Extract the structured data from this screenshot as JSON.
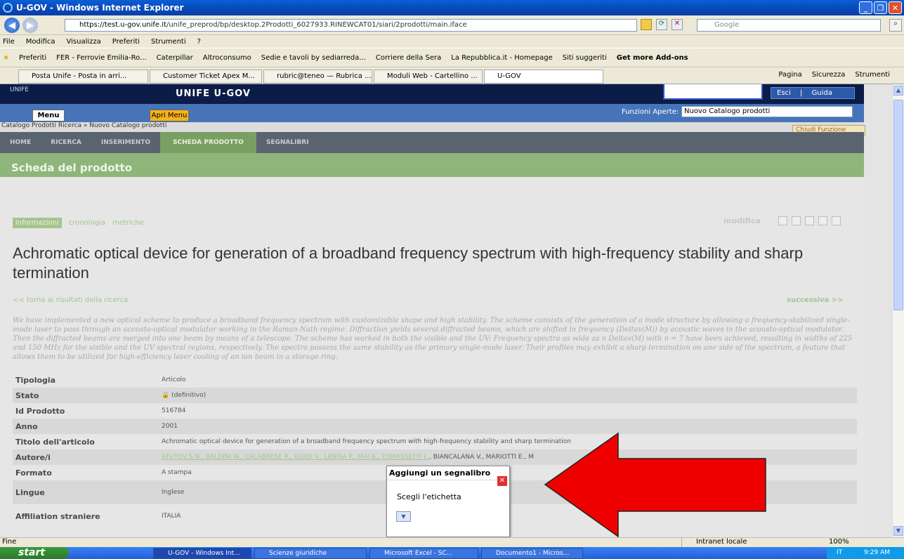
{
  "window": {
    "title": "U-GOV - Windows Internet Explorer"
  },
  "address": {
    "url_prefix": "https://test.u-gov.unife.it",
    "url_rest": "/unife_preprod/bp/desktop.2Prodotti_6027933.RINEWCAT01/siari/2prodotti/main.iface",
    "search_placeholder": "Google"
  },
  "menubar": [
    "File",
    "Modifica",
    "Visualizza",
    "Preferiti",
    "Strumenti",
    "?"
  ],
  "favorites": [
    "Preferiti",
    "FER - Ferrovie Emilia-Ro...",
    "Caterpillar",
    "Altroconsumo",
    "Sedie e tavoli by sediarreda...",
    "Corriere della Sera",
    "La Repubblica.it - Homepage",
    "Siti suggeriti",
    "Get more Add-ons"
  ],
  "tabs": [
    "Posta Unife - Posta in arri...",
    "Customer Ticket Apex M...",
    "rubric@teneo — Rubrica ...",
    "Moduli Web - Cartellino ...",
    "U-GOV"
  ],
  "tab_tools": [
    "Pagina",
    "Sicurezza",
    "Strumenti"
  ],
  "app": {
    "header_title": "UNIFE U-GOV",
    "logo_text": "UNIFE",
    "esci": "Esci",
    "guida": "Guida",
    "menu_btn": "Menu",
    "apri_menu": "Apri Menu",
    "funzioni_label": "Funzioni Aperte:",
    "funzioni_value": "Nuovo Catalogo prodotti",
    "breadcrumb": "Catalogo Prodotti Ricerca » Nuovo Catalogo prodotti",
    "chiudi": "Chiudi Funzione",
    "nav": [
      "HOME",
      "RICERCA",
      "INSERIMENTO",
      "SCHEDA PRODOTTO",
      "SEGNALIBRI"
    ],
    "section_title": "Scheda del prodotto",
    "info_tabs": [
      "informazioni",
      "cronologia",
      "metriche"
    ],
    "modifica": "modifica",
    "product_title": "Achromatic optical device for generation of a broadband frequency spectrum with high-frequency stability and sharp termination",
    "back_link": "<< torna ai risultati della ricerca",
    "next_link": "successiva >>",
    "abstract": "We have implemented a new optical scheme to produce a broadband frequency spectrum with customizable shape and high stability. The scheme consists of the generation of a mode structure by allowing a frequency-stabilized single-mode laser to pass through an acousto-optical modulator working in the Raman-Nath regime. Diffraction yields several diffracted beams, which are shifted in frequency (Deltav(M)) by acoustic waves in the acousto-optical modulator. Then the diffracted beams are merged into one beam by means of a telescope. The scheme has worked in both the visible and the UV: Frequency spectra as wide as n Deltav(M) with n = 7 have been achieved, resulting in widths of 225 and 150 MHz for the visible and the UV spectral regions, respectively. The spectra possess the same stability as the primary single-mode laser. Their profiles may exhibit a sharp termination on one side of the spectrum, a feature that allows them to be utilized for high-efficiency laser cooling of an ion beam in a storage ring.",
    "fields": [
      {
        "k": "Tipologia",
        "v": "Articolo"
      },
      {
        "k": "Stato",
        "v": "(definitivo)"
      },
      {
        "k": "Id Prodotto",
        "v": "516784"
      },
      {
        "k": "Anno",
        "v": "2001"
      },
      {
        "k": "Titolo dell'articolo",
        "v": "Achromatic optical device for generation of a broadband frequency spectrum with high-frequency stability and sharp termination"
      },
      {
        "k": "Autore/i",
        "v_link": "ATUTOV S.N., BALDINI W., CALABRESE R., GUIDI V., LENISA P., MAI B., TOMASSETTI L.",
        "v": ", BIANCALANA V., MARIOTTI E., M"
      },
      {
        "k": "Formato",
        "v": "A stampa"
      },
      {
        "k": "Lingue",
        "v": "Inglese"
      },
      {
        "k": "Affiliation straniere",
        "v": "ITALIA"
      }
    ]
  },
  "popup": {
    "title": "Aggiungi un segnalibro",
    "label": "Scegli l'etichetta"
  },
  "status": {
    "left": "Fine",
    "zone": "Intranet locale",
    "zoom": "100%"
  },
  "taskbar": {
    "start": "start",
    "items": [
      "U-GOV - Windows Int...",
      "Scienze giuridiche",
      "Microsoft Excel - SC...",
      "Documento1 - Micros..."
    ],
    "lang": "IT",
    "time": "9:29 AM"
  },
  "colors": {
    "accent_green": "#8fb57a",
    "header_navy": "#0b1c47",
    "arrow_red": "#ee0000"
  }
}
